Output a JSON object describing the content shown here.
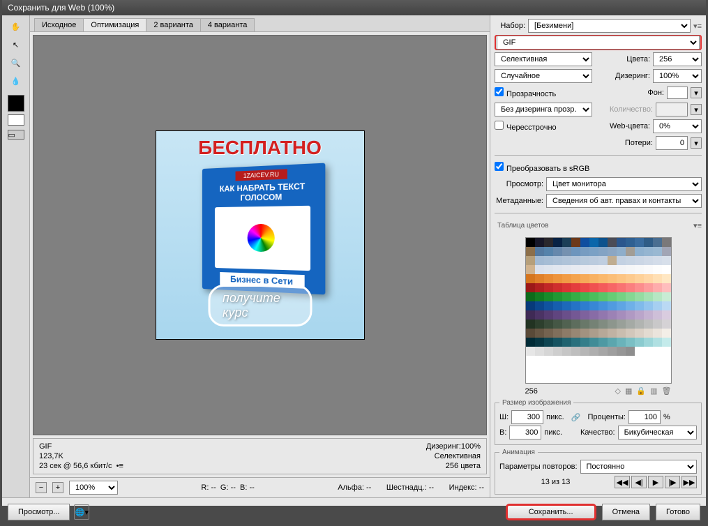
{
  "title": "Сохранить для Web (100%)",
  "tabs": [
    "Исходное",
    "Оптимизация",
    "2 варианта",
    "4 варианта"
  ],
  "activeTab": 1,
  "preview": {
    "headline": "БЕСПЛАТНО",
    "boxTop": "1ZAICEV.RU",
    "boxTitle": "КАК НАБРАТЬ ТЕКСТ ГОЛОСОМ",
    "boxBottom": "Бизнес в Сети",
    "cta": "получите курс"
  },
  "info": {
    "format": "GIF",
    "size": "123,7K",
    "time": "23 сек @ 56,6 кбит/с",
    "ditherLine": "Дизеринг:100%",
    "paletteLine": "Селективная",
    "colorsLine": "256 цвета"
  },
  "botbar": {
    "zoom": "100%",
    "R": "R: --",
    "G": "G: --",
    "B": "B: --",
    "alpha": "Альфа: --",
    "hex": "Шестнадц.: --",
    "index": "Индекс: --"
  },
  "panel": {
    "presetLabel": "Набор:",
    "preset": "[Безимени]",
    "format": "GIF",
    "reduction": "Селективная",
    "colorsLabel": "Цвета:",
    "colors": "256",
    "dither": "Случайное",
    "ditherLabel": "Дизеринг:",
    "ditherPct": "100%",
    "transparency": "Прозрачность",
    "matteLabel": "Фон:",
    "transDither": "Без дизеринга прозр…",
    "amountLabel": "Количество:",
    "interlaced": "Чересстрочно",
    "webSnapLabel": "Web-цвета:",
    "webSnap": "0%",
    "lossyLabel": "Потери:",
    "lossy": "0",
    "srgb": "Преобразовать в sRGB",
    "previewLabel": "Просмотр:",
    "preview": "Цвет монитора",
    "metaLabel": "Метаданные:",
    "meta": "Сведения об авт. правах и контакты",
    "colorTableLabel": "Таблица цветов",
    "ctCount": "256",
    "sizeTitle": "Размер изображения",
    "W": "Ш:",
    "H": "В:",
    "wVal": "300",
    "hVal": "300",
    "px": "пикс.",
    "pctLabel": "Проценты:",
    "pct": "100",
    "qualityLabel": "Качество:",
    "quality": "Бикубическая",
    "animTitle": "Анимация",
    "loopLabel": "Параметры повторов:",
    "loop": "Постоянно",
    "frame": "13 из 13"
  },
  "footer": {
    "preview": "Просмотр...",
    "save": "Сохранить...",
    "cancel": "Отмена",
    "done": "Готово"
  },
  "colorTable": [
    "#000000",
    "#171728",
    "#29272c",
    "#082244",
    "#1b3e57",
    "#6d391a",
    "#104e9f",
    "#0b66aa",
    "#0d528d",
    "#4b4c57",
    "#2b568c",
    "#2f6092",
    "#396b9e",
    "#2f5c86",
    "#4a6e91",
    "#7a7879",
    "#8c6f4a",
    "#547aa1",
    "#5683ab",
    "#6688ac",
    "#7591b0",
    "#6d95bd",
    "#779cc1",
    "#7ba1c5",
    "#83a3c4",
    "#8ba6c3",
    "#8eaecb",
    "#a29d95",
    "#8fb1cf",
    "#95b5d1",
    "#99b8d2",
    "#a1a5b5",
    "#b69f7a",
    "#a2bad3",
    "#a6bdd5",
    "#abc0d7",
    "#afc3d9",
    "#b3c5da",
    "#b7c9dc",
    "#bbcbde",
    "#bfcee0",
    "#c0ad90",
    "#c3d1e2",
    "#c7d4e3",
    "#cbd6e5",
    "#cfd9e7",
    "#d3dce9",
    "#d7dfea",
    "#d1b38e",
    "#dbe1ec",
    "#dee4ed",
    "#e1e6ef",
    "#e4e8f0",
    "#e7eaf1",
    "#eaecf2",
    "#eceef3",
    "#eef0f4",
    "#f1f2f5",
    "#f3f4f6",
    "#f5f6f7",
    "#f7f8f9",
    "#fafafb",
    "#fdfdfd",
    "#ffffff",
    "#d5751e",
    "#e0802a",
    "#e88a33",
    "#ed933c",
    "#f19b45",
    "#f4a34e",
    "#f6aa58",
    "#f8b162",
    "#fab86c",
    "#fbbe77",
    "#fcc482",
    "#fdca8d",
    "#fed199",
    "#ffd7a6",
    "#ffdfb4",
    "#ffe7c3",
    "#9c1818",
    "#b01f1f",
    "#c12626",
    "#cf2d2d",
    "#db3535",
    "#e43d3d",
    "#eb4646",
    "#f05050",
    "#f45b5b",
    "#f76666",
    "#f97272",
    "#fb7f7f",
    "#fc8d8d",
    "#fd9c9c",
    "#feacac",
    "#ffbdbd",
    "#0c6b1b",
    "#127c22",
    "#198b2a",
    "#219833",
    "#2aa43c",
    "#34ae46",
    "#3fb751",
    "#4bbf5d",
    "#58c669",
    "#66cc76",
    "#74d284",
    "#84d793",
    "#94dca2",
    "#a4e1b2",
    "#b6e7c3",
    "#c8ecd4",
    "#073a7a",
    "#0b478e",
    "#10539f",
    "#165eae",
    "#1d69ba",
    "#2573c5",
    "#2e7dce",
    "#3887d5",
    "#4491db",
    "#519be0",
    "#5fa5e4",
    "#6fb0e8",
    "#80baeb",
    "#92c4ee",
    "#a6cff1",
    "#bad9f4",
    "#3f2a55",
    "#4b3364",
    "#563c72",
    "#60457f",
    "#6a4f8a",
    "#745894",
    "#7e629d",
    "#886ca6",
    "#9277ae",
    "#9c82b5",
    "#a68dbc",
    "#b099c3",
    "#baa5ca",
    "#c4b2d1",
    "#cebfd8",
    "#d9ccdf",
    "#223322",
    "#2d3f2d",
    "#394b39",
    "#455745",
    "#516251",
    "#5d6d5d",
    "#697869",
    "#758275",
    "#818c81",
    "#8d968d",
    "#99a099",
    "#a5aaa5",
    "#b1b4b1",
    "#bdbebd",
    "#c9c8c9",
    "#d5d2d5",
    "#5a4a38",
    "#685744",
    "#756350",
    "#816f5c",
    "#8d7b68",
    "#988774",
    "#a29280",
    "#ac9d8c",
    "#b6a898",
    "#c0b2a3",
    "#c9bdaf",
    "#d2c7bb",
    "#dbd1c6",
    "#e3dbd1",
    "#ebe4dc",
    "#f3eee7",
    "#002b36",
    "#073642",
    "#0e4552",
    "#165361",
    "#1f626f",
    "#29707d",
    "#347e8a",
    "#408c97",
    "#4d99a3",
    "#5ba6ae",
    "#6ab3ba",
    "#7abfc4",
    "#8bcbcf",
    "#9dd6d9",
    "#b0e0e2",
    "#c4ebeb",
    "#e6e6e6",
    "#dedede",
    "#d6d6d6",
    "#cecece",
    "#c6c6c6",
    "#bebebe",
    "#b6b6b6",
    "#aeaeae",
    "#a6a6a6",
    "#9e9e9e",
    "#969696",
    "#8e8e8e",
    "#ffffff",
    "#ffffff",
    "#ffffff",
    "#ffffff"
  ]
}
